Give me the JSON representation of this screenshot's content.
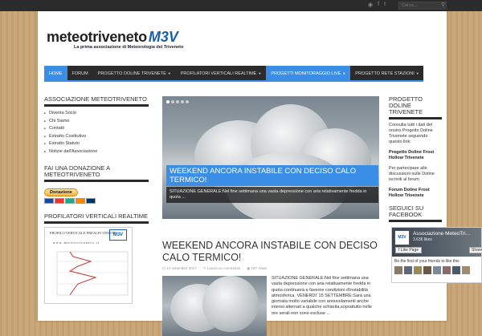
{
  "top": {
    "search_placeholder": "Cerca...",
    "icons": [
      "rss-icon",
      "facebook-icon",
      "twitter-icon",
      "search-icon"
    ]
  },
  "logo": {
    "part1": "meteo",
    "part2": "triveneto",
    "mark": "M3V",
    "tagline": "La prima associazione di Meteorologia del Triveneto"
  },
  "nav": [
    {
      "label": "HOME"
    },
    {
      "label": "FORUM"
    },
    {
      "label": "PROGETTO DOLINE TRIVENETE"
    },
    {
      "label": "PROFILATORI VERTICALI REALTIME"
    },
    {
      "label": "PROGETTI MONITORAGGIO LIVE"
    },
    {
      "label": "PROGETTO RETE STAZIONI"
    }
  ],
  "left": {
    "assoc_title": "ASSOCIAZIONE METEOTRIVENETO",
    "assoc_items": [
      "Diventa Socio",
      "Chi Siamo",
      "Contatti",
      "Estratto Costitutivo",
      "Estratto Statuto",
      "Notizie dall'Associazione"
    ],
    "donate_title": "FAI UNA DONAZIONE A METEOTRIVENETO",
    "donate_label": "Donazione",
    "profilers_title": "PROFILATORI VERTICALI REALTIME",
    "chart_title": "PROFILO VERTICALE FREALPI VENETE",
    "chart_url": "w w w . m e t e o t r i v e n e t o . i t",
    "chart_badge": "M3V"
  },
  "slider": {
    "title": "WEEKEND ANCORA INSTABILE CON DECISO CALO TERMICO!",
    "excerpt": "SITUAZIONE GENERALE:Nel fine settimana una vasta depressione con aria relativamente fredda in quota ..."
  },
  "post": {
    "title": "WEEKEND ANCORA INSTABILE CON DECISO CALO TERMICO!",
    "date": "14 settembre 2017",
    "comments": "Lascia un commento",
    "views": "187 Visite",
    "excerpt": "SITUAZIONE GENERALE:Nel fine settimana una vasta depressione con aria relativamente fredda in quota continuerà a favorire condizioni d'instabilità atmosferica. VENERDI' 15 SETTEMBRE:Sarà una giornata molto variabile con annuvolamenti anche intensi alternati a qualche schiarita,soprattutto nelle ore serali non sono escluse ..."
  },
  "right": {
    "doline_title": "PROGETTO DOLINE TRIVENETE",
    "doline_text": "Consulta tutti i dati del nostro Progetto Doline Trivenete seguendo questo link:",
    "doline_link": "Progetto Doline Frost Hollow Trivenete",
    "forum_text": "Per partecipare alle discussioni sulle Doline iscriviti al forum",
    "forum_link": "Forum Doline Frost Hollow Trivenete",
    "fb_title": "SEGUICI SU FACEBOOK"
  },
  "fb": {
    "name": "Associazione MeteoTri...",
    "likes": "3.636 likes",
    "like_btn": "Like Page",
    "share_btn": "Share",
    "text": "Be the first of your friends to like this",
    "logo": "M3V"
  }
}
